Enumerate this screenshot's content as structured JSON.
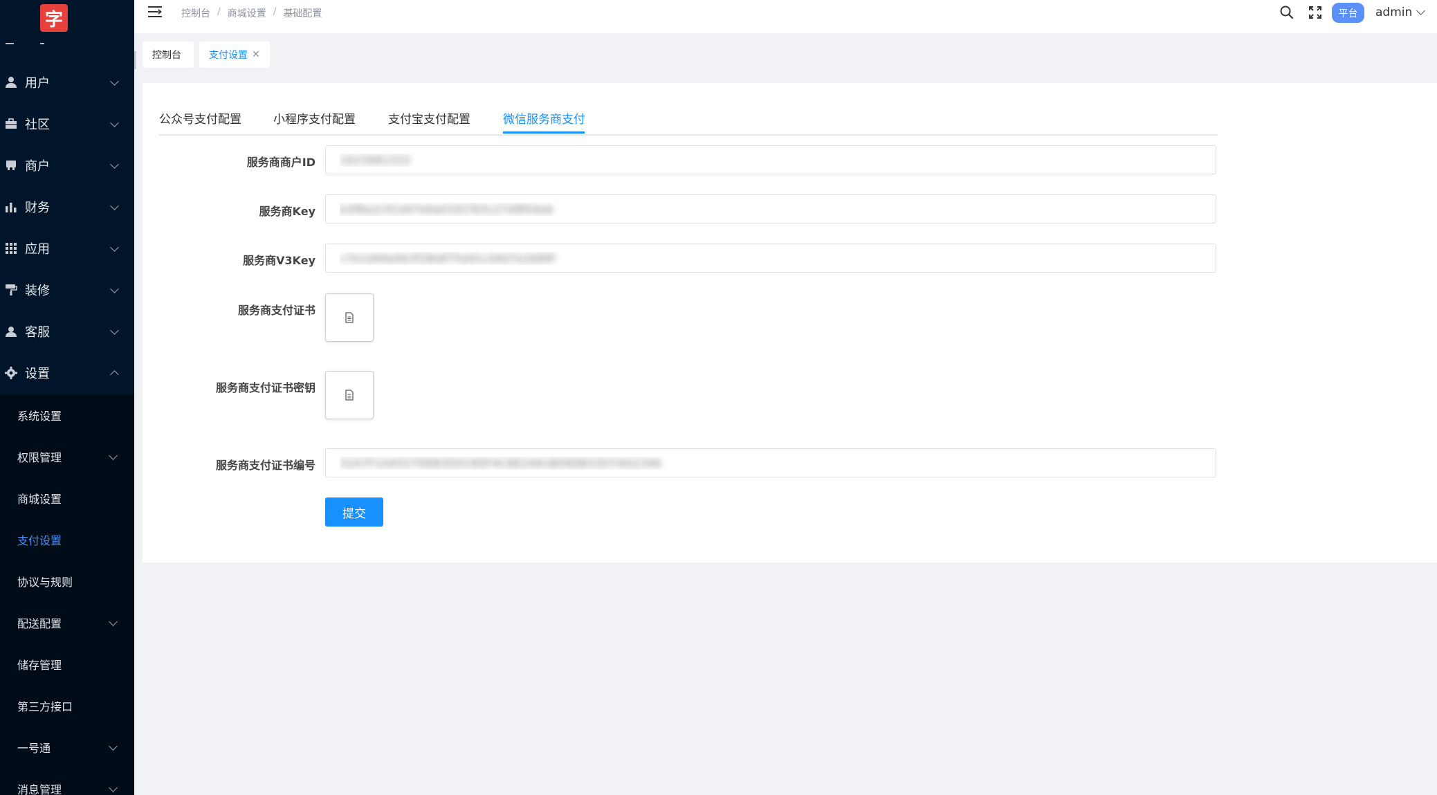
{
  "app": {
    "logo_text": "字"
  },
  "sidebar": {
    "items": [
      {
        "label": "用户",
        "icon": "user-icon"
      },
      {
        "label": "社区",
        "icon": "briefcase-icon"
      },
      {
        "label": "商户",
        "icon": "store-icon"
      },
      {
        "label": "财务",
        "icon": "bar-chart-icon"
      },
      {
        "label": "应用",
        "icon": "grid-icon"
      },
      {
        "label": "装修",
        "icon": "paint-roller-icon"
      },
      {
        "label": "客服",
        "icon": "headset-user-icon"
      },
      {
        "label": "设置",
        "icon": "gear-icon"
      }
    ],
    "submenu": [
      {
        "label": "系统设置"
      },
      {
        "label": "权限管理"
      },
      {
        "label": "商城设置"
      },
      {
        "label": "支付设置"
      },
      {
        "label": "协议与规则"
      },
      {
        "label": "配送配置"
      },
      {
        "label": "储存管理"
      },
      {
        "label": "第三方接口"
      },
      {
        "label": "一号通"
      },
      {
        "label": "消息管理"
      }
    ]
  },
  "header": {
    "breadcrumb": [
      "控制台",
      "商城设置",
      "基础配置"
    ],
    "platform_label": "平台",
    "user_name": "admin"
  },
  "tags": [
    {
      "label": "控制台"
    },
    {
      "label": "支付设置"
    }
  ],
  "payment_tabs": [
    "公众号支付配置",
    "小程序支付配置",
    "支付宝支付配置",
    "微信服务商支付"
  ],
  "form": {
    "merchant_id": {
      "label": "服务商商户ID",
      "value": "1623981333"
    },
    "key": {
      "label": "服务商Key",
      "value": "b3f8a2c91d47e6a0181Te5c27d9f04ab"
    },
    "v3key": {
      "label": "服务商V3Key",
      "value": "c7e1d49a0b3f28e6T5a91c04d7e2b86f"
    },
    "cert": {
      "label": "服务商支付证书"
    },
    "cert_key": {
      "label": "服务商支付证书密钥"
    },
    "cert_serial": {
      "label": "服务商支付证书编号",
      "value": "32A7F1A4557DEB3D019DF4C8E2A61B09DB33D7AD2346"
    },
    "submit_label": "提交"
  }
}
